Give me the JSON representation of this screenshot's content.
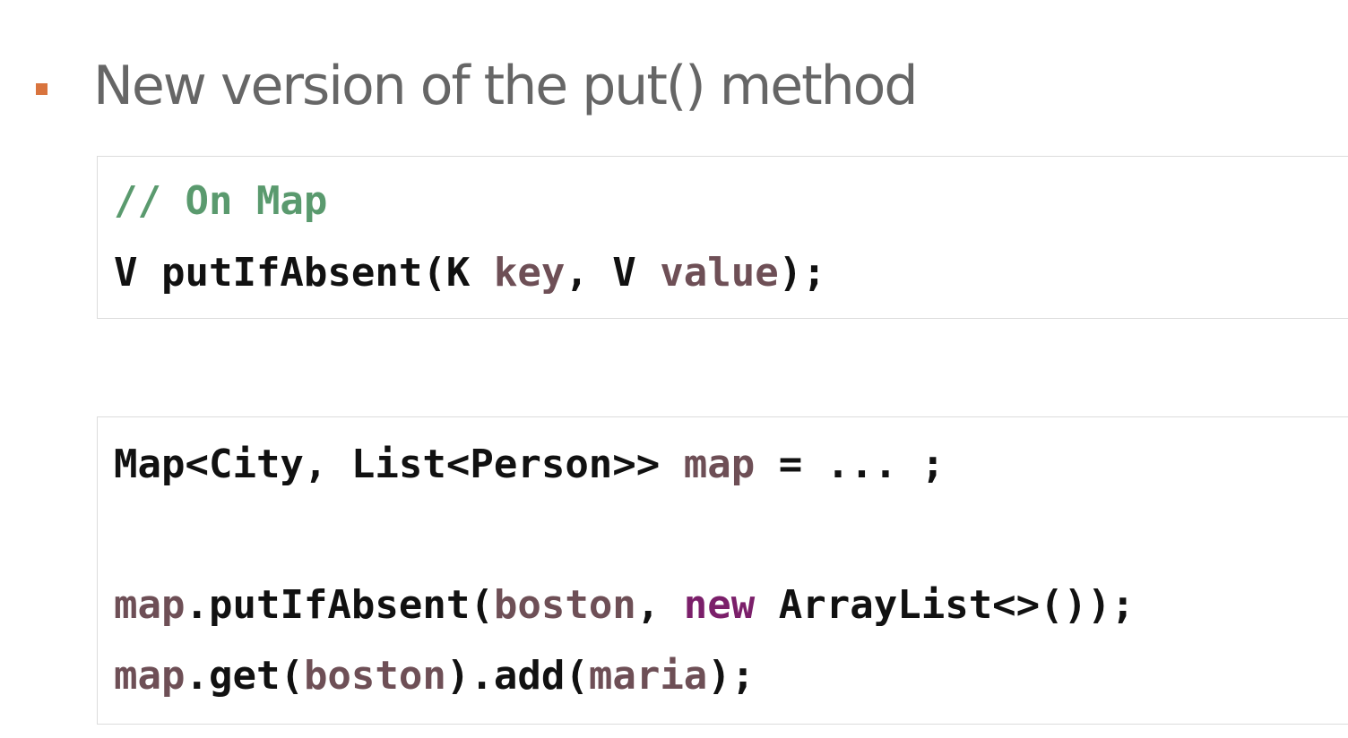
{
  "slide": {
    "heading": "New version of the put() method",
    "accent_color": "#d9743e",
    "bullet_icon": "square-bullet"
  },
  "code_block_1": {
    "line_1": {
      "comment": "// On Map"
    },
    "line_2": {
      "t1": "V putIfAbsent(K ",
      "t2": "key",
      "t3": ", V ",
      "t4": "value",
      "t5": ");"
    }
  },
  "code_block_2": {
    "line_1": {
      "t1": "Map<City, List<Person>> ",
      "t2": "map",
      "t3": " = ... ;"
    },
    "line_2": {
      "t1": "map",
      "t2": ".putIfAbsent(",
      "t3": "boston",
      "t4": ", ",
      "t5": "new",
      "t6": " ArrayList<>());"
    },
    "line_3": {
      "t1": "map",
      "t2": ".get(",
      "t3": "boston",
      "t4": ").add(",
      "t5": "maria",
      "t6": ");"
    }
  },
  "colors": {
    "comment": "#5a9a6e",
    "plain": "#111111",
    "identifier": "#6e4f56",
    "keyword": "#7b1f6a",
    "heading": "#666666"
  }
}
